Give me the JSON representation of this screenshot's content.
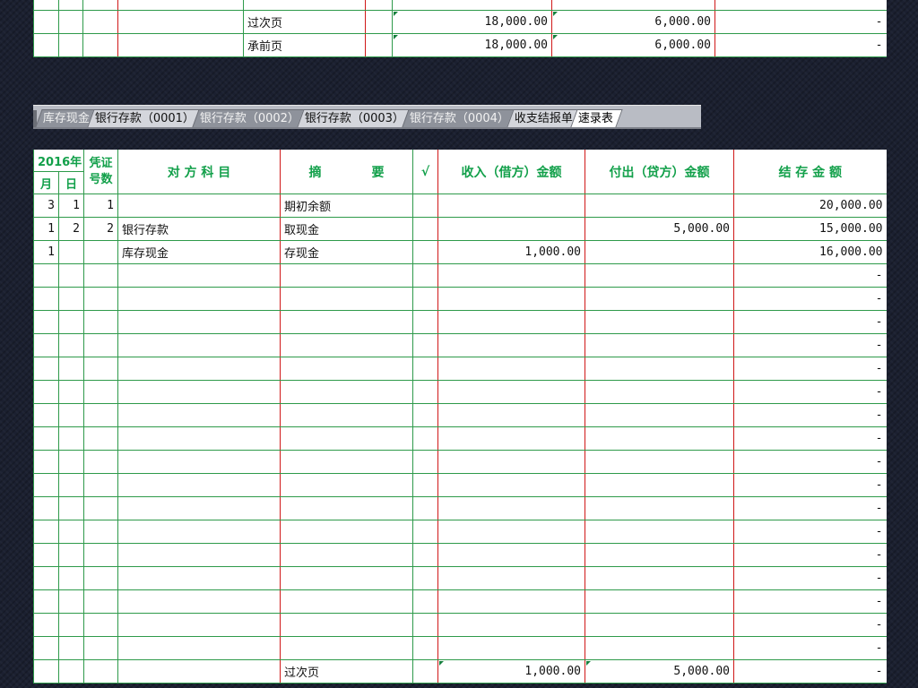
{
  "top_rows": [
    {
      "summary": "",
      "debit": "",
      "credit": "",
      "balance": "-"
    },
    {
      "summary": "过次页",
      "debit": "18,000.00",
      "credit": "6,000.00",
      "balance": "-"
    },
    {
      "summary": "承前页",
      "debit": "18,000.00",
      "credit": "6,000.00",
      "balance": "-"
    }
  ],
  "sheet_tabs": [
    {
      "label": "库存现金",
      "state": "dim"
    },
    {
      "label": "银行存款（0001）",
      "state": "normal"
    },
    {
      "label": "银行存款（0002）",
      "state": "dim"
    },
    {
      "label": "银行存款（0003）",
      "state": "normal"
    },
    {
      "label": "银行存款（0004）",
      "state": "dim"
    },
    {
      "label": "收支结报单",
      "state": "normal"
    },
    {
      "label": "速录表",
      "state": "active"
    }
  ],
  "header": {
    "year": "2016年",
    "month": "月",
    "day": "日",
    "voucher": "凭证号数",
    "account": "对 方 科 目",
    "summary": "摘　　　　要",
    "check": "√",
    "debit": "收入（借方）金额",
    "credit": "付出（贷方）金额",
    "balance": "结 存 金 额"
  },
  "rows": [
    {
      "month": "3",
      "day": "1",
      "voucher": "1",
      "account": "",
      "summary": "期初余额",
      "debit": "",
      "credit": "",
      "balance": "20,000.00",
      "style": "red"
    },
    {
      "month": "1",
      "day": "2",
      "voucher": "2",
      "account": "银行存款",
      "summary": "取现金",
      "debit": "",
      "credit": "5,000.00",
      "balance": "15,000.00"
    },
    {
      "month": "1",
      "day": "",
      "voucher": "",
      "account": "库存现金",
      "summary": "存现金",
      "debit": "1,000.00",
      "credit": "",
      "balance": "16,000.00"
    },
    {
      "balance": "-"
    },
    {
      "balance": "-"
    },
    {
      "balance": "-"
    },
    {
      "balance": "-"
    },
    {
      "balance": "-"
    },
    {
      "balance": "-"
    },
    {
      "balance": "-"
    },
    {
      "balance": "-"
    },
    {
      "balance": "-"
    },
    {
      "balance": "-"
    },
    {
      "balance": "-"
    },
    {
      "balance": "-"
    },
    {
      "balance": "-"
    },
    {
      "balance": "-"
    },
    {
      "balance": "-"
    },
    {
      "balance": "-"
    },
    {
      "balance": "-"
    },
    {
      "summary": "过次页",
      "debit": "1,000.00",
      "credit": "5,000.00",
      "balance": "-",
      "totals": true
    }
  ]
}
